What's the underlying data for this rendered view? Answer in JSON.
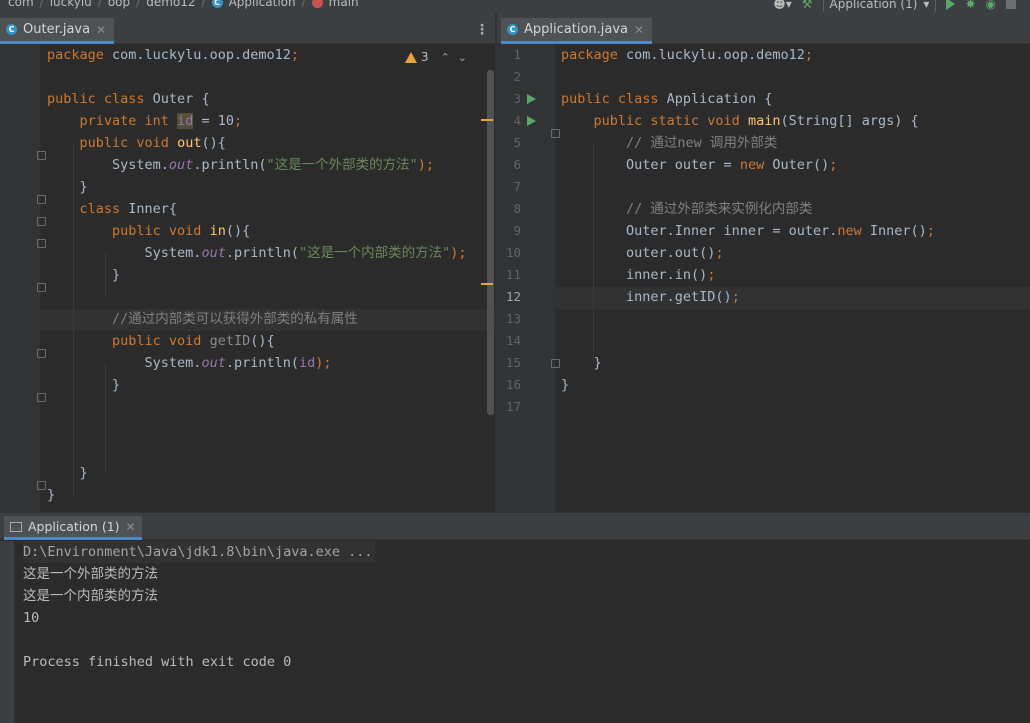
{
  "navbar": {
    "crumbs": [
      "com",
      "luckylu",
      "oop",
      "demo12"
    ],
    "class_crumb": "Application",
    "method_crumb": "main",
    "run_config": "Application (1)"
  },
  "left_editor": {
    "tab_label": "Outer.java",
    "warning_count": "3",
    "lines": [
      [
        {
          "t": "package ",
          "c": "kw"
        },
        {
          "t": "com.luckylu.oop.demo12"
        },
        {
          "t": ";",
          "c": "kw"
        }
      ],
      [],
      [
        {
          "t": "public class ",
          "c": "kw"
        },
        {
          "t": "Outer {"
        }
      ],
      [
        {
          "t": "    "
        },
        {
          "t": "private int ",
          "c": "kw"
        },
        {
          "t": "id",
          "c": "hl-id"
        },
        {
          "t": " = "
        },
        {
          "t": "10",
          "c": "num"
        },
        {
          "t": ";",
          "c": "kw"
        }
      ],
      [
        {
          "t": "    "
        },
        {
          "t": "public void ",
          "c": "kw"
        },
        {
          "t": "out",
          "c": "fn"
        },
        {
          "t": "(){"
        }
      ],
      [
        {
          "t": "        System."
        },
        {
          "t": "out",
          "c": "sfld"
        },
        {
          "t": ".println("
        },
        {
          "t": "\"这是一个外部类的方法\"",
          "c": "str"
        },
        {
          "t": ");",
          "c": "kw"
        }
      ],
      [
        {
          "t": "    }"
        }
      ],
      [
        {
          "t": "    "
        },
        {
          "t": "class ",
          "c": "kw"
        },
        {
          "t": "Inner{"
        }
      ],
      [
        {
          "t": "        "
        },
        {
          "t": "public void ",
          "c": "kw"
        },
        {
          "t": "in",
          "c": "fn"
        },
        {
          "t": "(){"
        }
      ],
      [
        {
          "t": "            System."
        },
        {
          "t": "out",
          "c": "sfld"
        },
        {
          "t": ".println("
        },
        {
          "t": "\"这是一个内部类的方法\"",
          "c": "str"
        },
        {
          "t": ");",
          "c": "kw"
        }
      ],
      [
        {
          "t": "        }"
        }
      ],
      [],
      [
        {
          "t": "        "
        },
        {
          "t": "//通过内部类可以获得外部类的私有属性",
          "c": "cmt"
        }
      ],
      [
        {
          "t": "        "
        },
        {
          "t": "public void ",
          "c": "kw"
        },
        {
          "t": "getID",
          "c": "unused"
        },
        {
          "t": "(){"
        }
      ],
      [
        {
          "t": "            System."
        },
        {
          "t": "out",
          "c": "sfld"
        },
        {
          "t": ".println("
        },
        {
          "t": "id",
          "c": "fld"
        },
        {
          "t": ");",
          "c": "kw"
        }
      ],
      [
        {
          "t": "        }"
        }
      ],
      [],
      [],
      [],
      [
        {
          "t": "    }"
        }
      ],
      [
        {
          "t": "}"
        }
      ]
    ]
  },
  "right_editor": {
    "tab_label": "Application.java",
    "line_numbers": [
      "1",
      "2",
      "3",
      "4",
      "5",
      "6",
      "7",
      "8",
      "9",
      "10",
      "11",
      "12",
      "13",
      "14",
      "15",
      "16",
      "17"
    ],
    "lines": [
      [
        {
          "t": "package ",
          "c": "kw"
        },
        {
          "t": "com.luckylu.oop.demo12"
        },
        {
          "t": ";",
          "c": "kw"
        }
      ],
      [],
      [
        {
          "t": "public class ",
          "c": "kw"
        },
        {
          "t": "Application {"
        }
      ],
      [
        {
          "t": "    "
        },
        {
          "t": "public static void ",
          "c": "kw"
        },
        {
          "t": "main",
          "c": "fn"
        },
        {
          "t": "(String[] args) {"
        }
      ],
      [
        {
          "t": "        "
        },
        {
          "t": "// 通过new 调用外部类",
          "c": "cmt"
        }
      ],
      [
        {
          "t": "        Outer outer = "
        },
        {
          "t": "new ",
          "c": "kw"
        },
        {
          "t": "Outer()"
        },
        {
          "t": ";",
          "c": "kw"
        }
      ],
      [],
      [
        {
          "t": "        "
        },
        {
          "t": "// 通过外部类来实例化内部类",
          "c": "cmt"
        }
      ],
      [
        {
          "t": "        Outer.Inner inner = outer."
        },
        {
          "t": "new ",
          "c": "kw"
        },
        {
          "t": "Inner()"
        },
        {
          "t": ";",
          "c": "kw"
        }
      ],
      [
        {
          "t": "        outer.out()"
        },
        {
          "t": ";",
          "c": "kw"
        }
      ],
      [
        {
          "t": "        inner.in()"
        },
        {
          "t": ";",
          "c": "kw"
        }
      ],
      [
        {
          "t": "        inner.getID()"
        },
        {
          "t": ";",
          "c": "kw"
        }
      ],
      [],
      [],
      [
        {
          "t": "    }"
        }
      ],
      [
        {
          "t": "}"
        }
      ],
      []
    ]
  },
  "run_panel": {
    "tab_label": "Application (1)",
    "console": [
      "D:\\Environment\\Java\\jdk1.8\\bin\\java.exe ...",
      "这是一个外部类的方法",
      "这是一个内部类的方法",
      "10",
      "",
      "Process finished with exit code 0"
    ]
  },
  "colors": {
    "keyword": "#cc7832",
    "string": "#6a8759",
    "comment": "#808080",
    "field": "#9876aa",
    "method": "#ffc66d",
    "run": "#59a869",
    "warning": "#e8a33c",
    "tab_underline": "#4a88c7"
  }
}
